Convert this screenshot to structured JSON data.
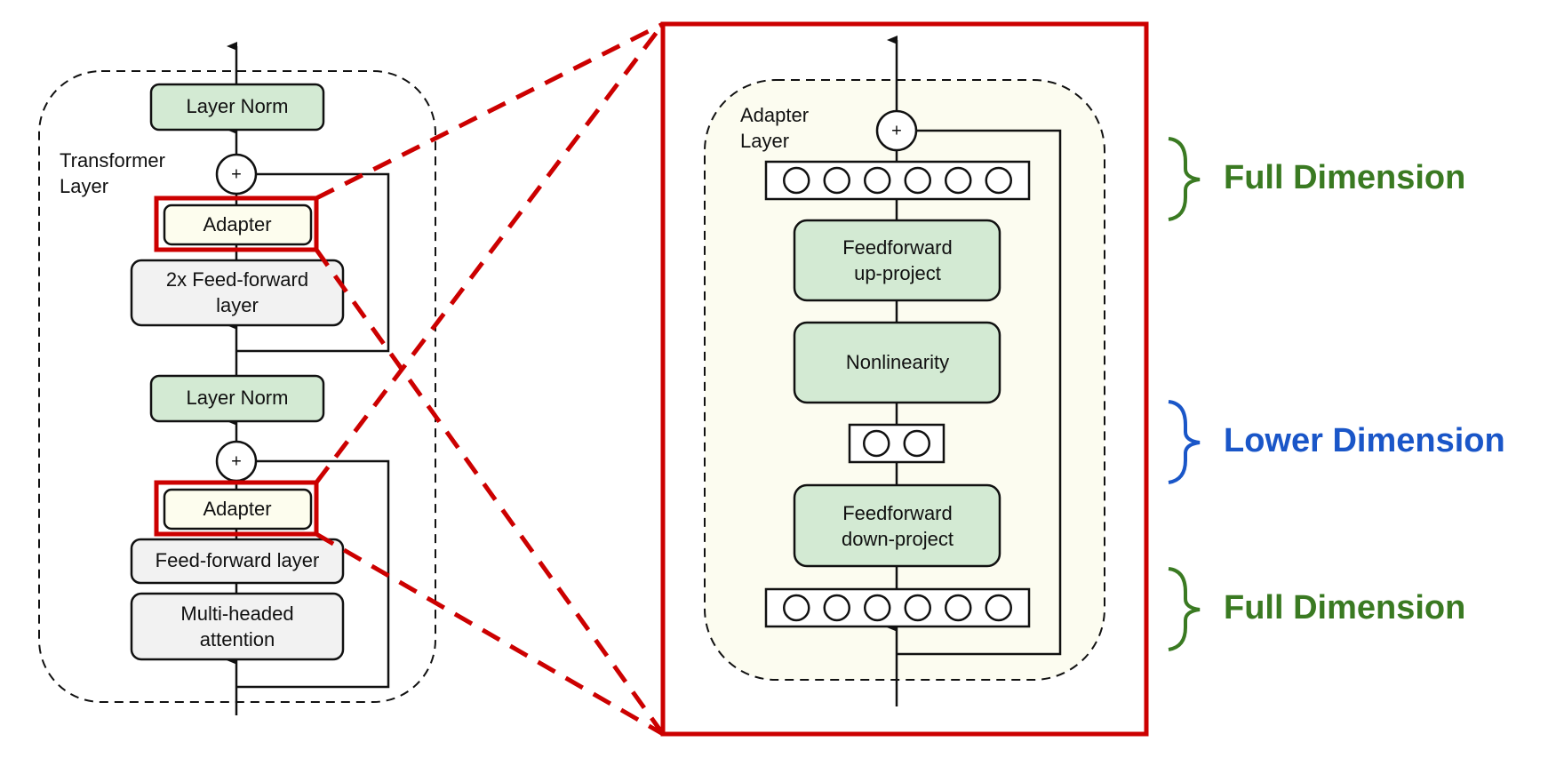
{
  "colors": {
    "highlight_red": "#cc0000",
    "full_dimension_green": "#3a7a22",
    "lower_dimension_blue": "#1a56c8",
    "layer_norm_fill": "#d3ead3",
    "adapter_fill": "#fdfdee",
    "feedforward_fill": "#f2f2f2",
    "adapter_layer_bg": "#fcfcf0",
    "adapter_block_fill": "#d3ead3"
  },
  "transformer_layer": {
    "title_line1": "Transformer",
    "title_line2": "Layer",
    "blocks": {
      "layer_norm_top": "Layer Norm",
      "adapter_top": "Adapter",
      "feedforward_2x_line1": "2x Feed-forward",
      "feedforward_2x_line2": "layer",
      "layer_norm_bottom": "Layer Norm",
      "adapter_bottom": "Adapter",
      "feedforward": "Feed-forward layer",
      "attention_line1": "Multi-headed",
      "attention_line2": "attention"
    },
    "sum_symbol": "+"
  },
  "adapter_layer": {
    "title_line1": "Adapter",
    "title_line2": "Layer",
    "sum_symbol": "+",
    "blocks": {
      "up_project_line1": "Feedforward",
      "up_project_line2": "up-project",
      "nonlinearity": "Nonlinearity",
      "down_project_line1": "Feedforward",
      "down_project_line2": "down-project"
    },
    "full_neuron_count": 6,
    "lower_neuron_count": 2
  },
  "annotations": {
    "top": "Full Dimension",
    "middle": "Lower Dimension",
    "bottom": "Full Dimension"
  }
}
